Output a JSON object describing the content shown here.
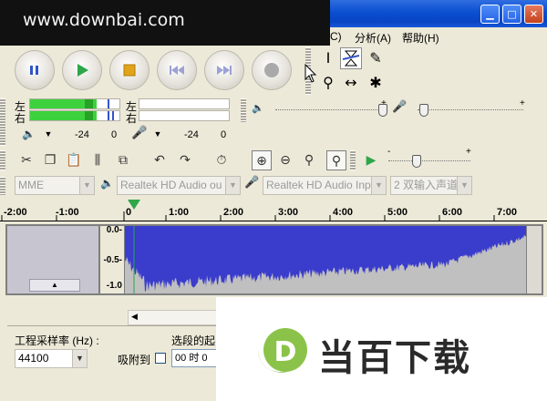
{
  "watermark_top": "www.downbai.com",
  "menu": {
    "items": [
      "C)",
      "分析(A)",
      "帮助(H)"
    ]
  },
  "transport": {
    "buttons": [
      "pause",
      "play",
      "stop",
      "skip-to-start",
      "skip-to-end",
      "record"
    ]
  },
  "meters": {
    "left_label": "左",
    "right_label": "右",
    "play_left_level": 0.74,
    "play_right_level": 0.74,
    "db_play_low": "-24",
    "db_play_high": "0",
    "db_rec_low": "-24",
    "db_rec_high": "0"
  },
  "mixer": {
    "plus_1": "+",
    "plus_2": "+",
    "output_volume": 0.86,
    "input_volume": 0.08,
    "speed_plus": "+",
    "speed_minus": "-"
  },
  "device": {
    "host": "MME",
    "output_device": "Realtek HD Audio ou",
    "input_device": "Realtek HD Audio Inp",
    "channels": "2 双输入声道"
  },
  "timeline": {
    "ticks": [
      "-2:00",
      "-1:00",
      "0",
      "1:00",
      "2:00",
      "3:00",
      "4:00",
      "5:00",
      "6:00",
      "7:00"
    ]
  },
  "track": {
    "scale": [
      "0.0-",
      "-0.5-",
      "-1.0"
    ]
  },
  "bottom": {
    "rate_label": "工程采样率 (Hz) :",
    "rate_value": "44100",
    "snap_label": "吸附到",
    "selection_label": "选段的起",
    "time_value": "00",
    "time_unit": "时",
    "time_value_2": "0"
  },
  "watermark_bottom": {
    "logo_letter": "D",
    "text": "当百下载"
  },
  "colors": {
    "waveform": "#3a3ccc",
    "meter_green": "#3dd23d",
    "title_blue": "#0a4fd0"
  }
}
